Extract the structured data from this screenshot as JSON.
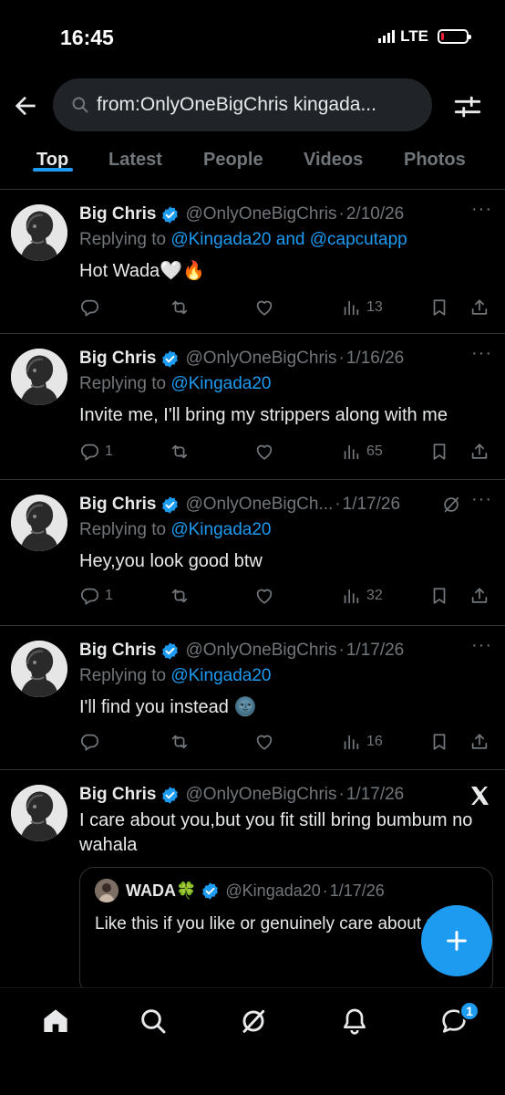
{
  "status": {
    "time": "16:45",
    "network": "LTE",
    "battery_level": 0.1
  },
  "search": {
    "query": "from:OnlyOneBigChris kingada..."
  },
  "tabs": [
    "Top",
    "Latest",
    "People",
    "Videos",
    "Photos"
  ],
  "active_tab": "Top",
  "tweets": [
    {
      "name": "Big Chris",
      "handle": "@OnlyOneBigChris",
      "dot": "·",
      "date": "2/10/26",
      "replying_prefix": "Replying to ",
      "replying_to": "@Kingada20 and @capcutapp",
      "text": "Hot Wada🤍🔥",
      "replies": "",
      "views": "13"
    },
    {
      "name": "Big Chris",
      "handle": "@OnlyOneBigChris",
      "dot": "·",
      "date": "1/16/26",
      "replying_prefix": "Replying to ",
      "replying_to": "@Kingada20",
      "text": "Invite me, I'll bring my strippers along with me",
      "replies": "1",
      "views": "65"
    },
    {
      "name": "Big Chris",
      "handle": "@OnlyOneBigCh...",
      "dot": "·",
      "date": "1/17/26",
      "replying_prefix": "Replying to ",
      "replying_to": "@Kingada20",
      "text": "Hey,you look good btw",
      "replies": "1",
      "views": "32"
    },
    {
      "name": "Big Chris",
      "handle": "@OnlyOneBigChris",
      "dot": "·",
      "date": "1/17/26",
      "replying_prefix": "Replying to ",
      "replying_to": "@Kingada20",
      "text": "I'll find you instead 🌚",
      "replies": "",
      "views": "16"
    },
    {
      "name": "Big Chris",
      "handle": "@OnlyOneBigChris",
      "dot": "·",
      "date": "1/17/26",
      "text": "I care about you,but you fit still bring bumbum no wahala",
      "quote": {
        "name": "WADA🍀",
        "handle": "@Kingada20",
        "dot": "·",
        "date": "1/17/26",
        "text": "Like this if you like or genuinely care about me"
      }
    }
  ],
  "nav": {
    "messages_badge": "1"
  },
  "colors": {
    "accent": "#1d9bf0",
    "muted": "#71767b",
    "background": "#000000",
    "divider": "#2f3336"
  }
}
